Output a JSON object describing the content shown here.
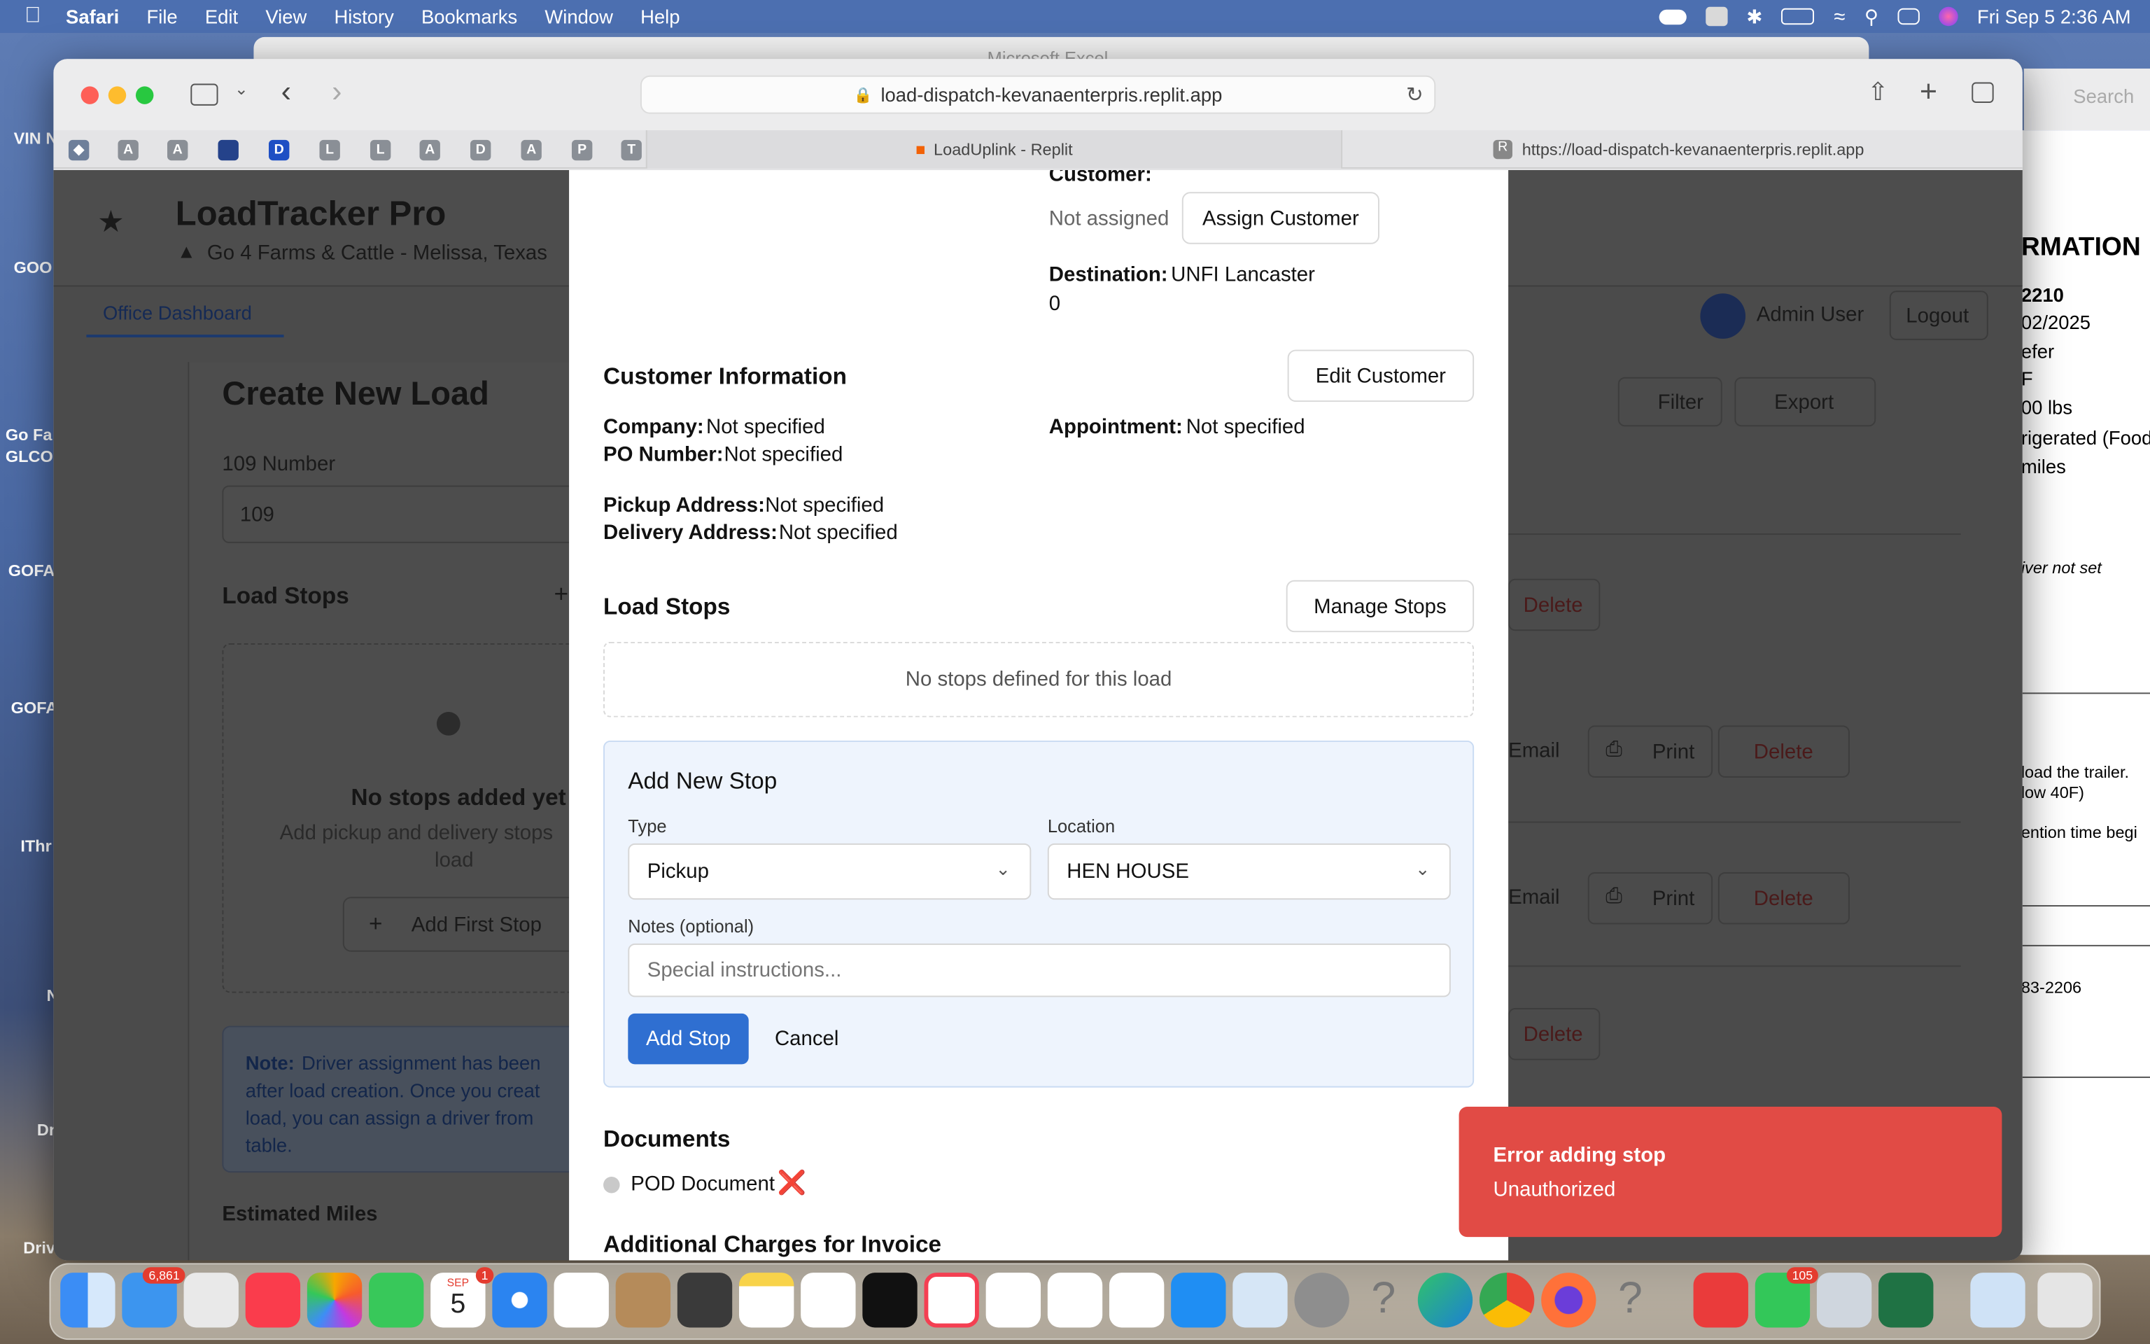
{
  "menubar": {
    "app": "Safari",
    "items": [
      "File",
      "Edit",
      "View",
      "History",
      "Bookmarks",
      "Window",
      "Help"
    ],
    "clock": "Fri Sep 5  2:36 AM"
  },
  "desktop_labels": [
    "VIN N",
    "GOO",
    "Go Fa",
    "GLCO",
    "GOFA",
    "GOFA",
    "IThr",
    "N",
    "Dr",
    "Driv"
  ],
  "behind_window": {
    "title": "Microsoft Excel",
    "search": "Search"
  },
  "bg_doc": {
    "title": "RMATION",
    "lines": [
      "2210",
      "02/2025",
      "efer",
      "F",
      "00 lbs",
      "rigerated (Food",
      "miles"
    ],
    "italic": "iver not set",
    "notes": [
      "load the trailer.",
      "low 40F)",
      "ention time begi"
    ],
    "phone": "83-2206"
  },
  "browser": {
    "url": "load-dispatch-kevanaenterpris.replit.app",
    "favorites": [
      "A",
      "A",
      "",
      "D",
      "L",
      "L",
      "A",
      "D",
      "A",
      "P",
      "T"
    ],
    "tabs": [
      {
        "title": "LoadUplink - Replit"
      },
      {
        "title": "https://load-dispatch-kevanaenterpris.replit.app"
      }
    ]
  },
  "app": {
    "title": "LoadTracker Pro",
    "subtitle": "Go 4 Farms & Cattle - Melissa, Texas",
    "nav_tab": "Office Dashboard",
    "user": "Admin User",
    "logout": "Logout",
    "create_title": "Create New Load",
    "number_label": "109 Number",
    "number_value": "109",
    "load_stops_label": "Load Stops",
    "no_stops_title": "No stops added yet",
    "no_stops_desc1": "Add pickup and delivery stops",
    "no_stops_desc2": "load",
    "add_first_stop": "Add First Stop",
    "note_label": "Note:",
    "note_lines": [
      "Driver assignment has been",
      "after load creation. Once you creat",
      "load, you can assign a driver from",
      "table."
    ],
    "estimated_miles": "Estimated Miles",
    "filter": "Filter",
    "export": "Export",
    "delete": "Delete",
    "email": "Email",
    "print": "Print"
  },
  "modal": {
    "customer_label": "Customer:",
    "customer_value": "Not assigned",
    "assign_customer": "Assign Customer",
    "destination_label": "Destination:",
    "destination_value": "UNFI Lancaster",
    "destination_extra": "0",
    "customer_info_title": "Customer Information",
    "edit_customer": "Edit Customer",
    "company_label": "Company:",
    "company_value": "Not specified",
    "po_label": "PO Number:",
    "po_value": "Not specified",
    "appointment_label": "Appointment:",
    "appointment_value": "Not specified",
    "pickup_label": "Pickup Address:",
    "pickup_value": "Not specified",
    "delivery_label": "Delivery Address:",
    "delivery_value": "Not specified",
    "load_stops_title": "Load Stops",
    "manage_stops": "Manage Stops",
    "no_stops": "No stops defined for this load",
    "add_stop_title": "Add New Stop",
    "type_label": "Type",
    "type_value": "Pickup",
    "location_label": "Location",
    "location_value": "HEN HOUSE",
    "notes_label": "Notes (optional)",
    "notes_placeholder": "Special instructions...",
    "add_stop_button": "Add Stop",
    "cancel_button": "Cancel",
    "documents_title": "Documents",
    "pod_document": "POD Document",
    "pod_status": "❌",
    "charges_title": "Additional Charges for Invoice"
  },
  "toast": {
    "title": "Error adding stop",
    "message": "Unauthorized",
    "color": "#e14b45"
  },
  "dock": {
    "mail_badge": "6,861",
    "calendar_month": "SEP",
    "calendar_day": "5",
    "calendar_badge": "1",
    "messages_badge": "105"
  }
}
